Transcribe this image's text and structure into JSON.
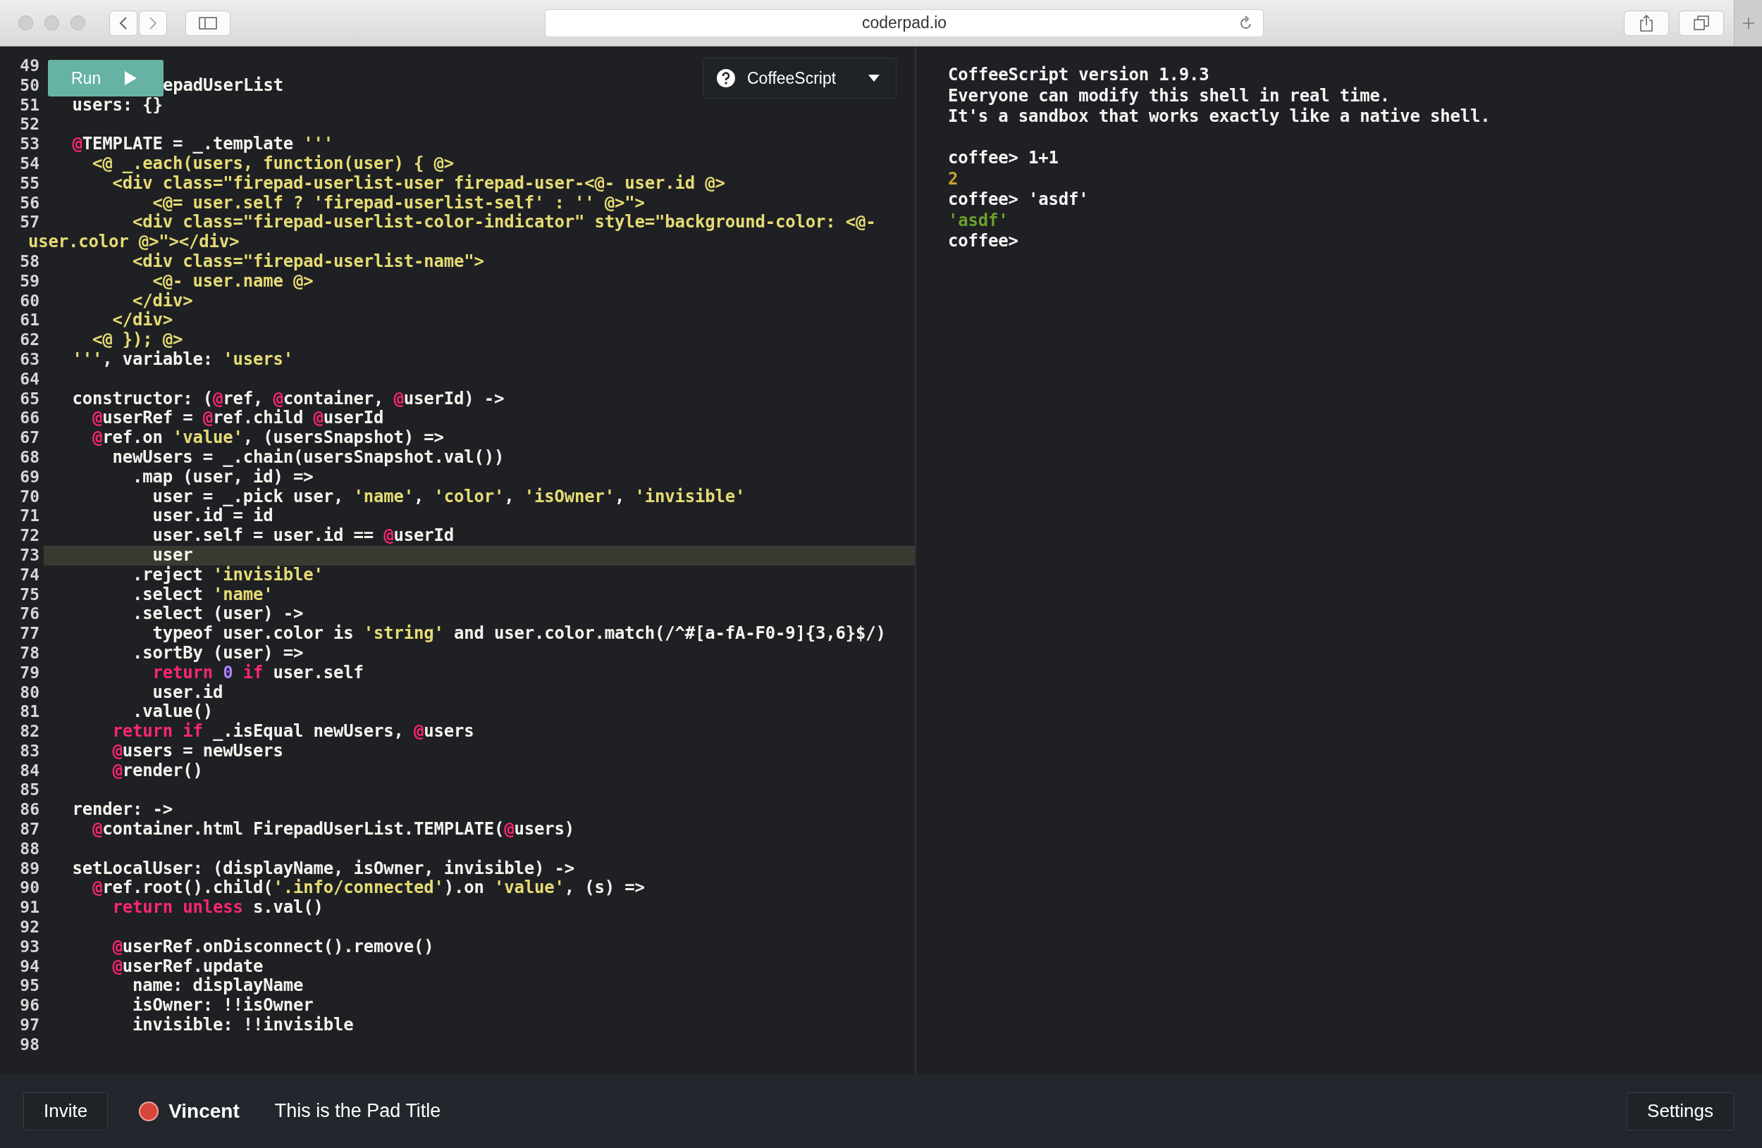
{
  "browser": {
    "url": "coderpad.io"
  },
  "editor": {
    "run_button": "Run",
    "language": "CoffeeScript",
    "lines": [
      {
        "number": "49",
        "active": false
      },
      {
        "number": "50",
        "active": false,
        "covered": true,
        "segments": [
          {
            "kind": "plain",
            "text": "epadUserList"
          }
        ]
      },
      {
        "number": "51",
        "active": false,
        "segments": [
          {
            "kind": "plain",
            "text": "  users: {}"
          }
        ]
      },
      {
        "number": "52",
        "active": false
      },
      {
        "number": "53",
        "active": false,
        "segments": [
          {
            "kind": "at",
            "text": "  @"
          },
          {
            "kind": "plain",
            "text": "TEMPLATE = _.template "
          },
          {
            "kind": "string",
            "text": "'''"
          }
        ]
      },
      {
        "number": "54",
        "active": false,
        "segments": [
          {
            "kind": "string",
            "text": "    <@ _.each(users, function(user) { @>"
          }
        ]
      },
      {
        "number": "55",
        "active": false,
        "segments": [
          {
            "kind": "string",
            "text": "      <div class=\"firepad-userlist-user firepad-user-<@- user.id @>"
          }
        ]
      },
      {
        "number": "56",
        "active": false,
        "segments": [
          {
            "kind": "string",
            "text": "          <@= user.self ? 'firepad-userlist-self' : '' @>\">"
          }
        ]
      },
      {
        "number": "57",
        "active": false,
        "segments": [
          {
            "kind": "string",
            "text": "        <div class=\"firepad-userlist-color-indicator\" style=\"background-color: <@-"
          }
        ],
        "wrap_segments": [
          {
            "kind": "string",
            "text": "user.color @>\"></div>"
          }
        ]
      },
      {
        "number": "58",
        "active": false,
        "segments": [
          {
            "kind": "string",
            "text": "        <div class=\"firepad-userlist-name\">"
          }
        ]
      },
      {
        "number": "59",
        "active": false,
        "segments": [
          {
            "kind": "string",
            "text": "          <@- user.name @>"
          }
        ]
      },
      {
        "number": "60",
        "active": false,
        "segments": [
          {
            "kind": "string",
            "text": "        </div>"
          }
        ]
      },
      {
        "number": "61",
        "active": false,
        "segments": [
          {
            "kind": "string",
            "text": "      </div>"
          }
        ]
      },
      {
        "number": "62",
        "active": false,
        "segments": [
          {
            "kind": "string",
            "text": "    <@ }); @>"
          }
        ]
      },
      {
        "number": "63",
        "active": false,
        "segments": [
          {
            "kind": "string",
            "text": "  '''"
          },
          {
            "kind": "plain",
            "text": ", variable: "
          },
          {
            "kind": "string",
            "text": "'users'"
          }
        ]
      },
      {
        "number": "64",
        "active": false
      },
      {
        "number": "65",
        "active": false,
        "segments": [
          {
            "kind": "plain",
            "text": "  constructor: ("
          },
          {
            "kind": "at",
            "text": "@"
          },
          {
            "kind": "plain",
            "text": "ref, "
          },
          {
            "kind": "at",
            "text": "@"
          },
          {
            "kind": "plain",
            "text": "container, "
          },
          {
            "kind": "at",
            "text": "@"
          },
          {
            "kind": "plain",
            "text": "userId) ->"
          }
        ]
      },
      {
        "number": "66",
        "active": false,
        "segments": [
          {
            "kind": "at",
            "text": "    @"
          },
          {
            "kind": "plain",
            "text": "userRef = "
          },
          {
            "kind": "at",
            "text": "@"
          },
          {
            "kind": "plain",
            "text": "ref.child "
          },
          {
            "kind": "at",
            "text": "@"
          },
          {
            "kind": "plain",
            "text": "userId"
          }
        ]
      },
      {
        "number": "67",
        "active": false,
        "segments": [
          {
            "kind": "at",
            "text": "    @"
          },
          {
            "kind": "plain",
            "text": "ref.on "
          },
          {
            "kind": "string",
            "text": "'value'"
          },
          {
            "kind": "plain",
            "text": ", (usersSnapshot) =>"
          }
        ]
      },
      {
        "number": "68",
        "active": false,
        "segments": [
          {
            "kind": "plain",
            "text": "      newUsers = _.chain(usersSnapshot.val())"
          }
        ]
      },
      {
        "number": "69",
        "active": false,
        "segments": [
          {
            "kind": "plain",
            "text": "        .map (user, id) =>"
          }
        ]
      },
      {
        "number": "70",
        "active": false,
        "segments": [
          {
            "kind": "plain",
            "text": "          user = _.pick user, "
          },
          {
            "kind": "string",
            "text": "'name'"
          },
          {
            "kind": "plain",
            "text": ", "
          },
          {
            "kind": "string",
            "text": "'color'"
          },
          {
            "kind": "plain",
            "text": ", "
          },
          {
            "kind": "string",
            "text": "'isOwner'"
          },
          {
            "kind": "plain",
            "text": ", "
          },
          {
            "kind": "string",
            "text": "'invisible'"
          }
        ]
      },
      {
        "number": "71",
        "active": false,
        "segments": [
          {
            "kind": "plain",
            "text": "          user.id = id"
          }
        ]
      },
      {
        "number": "72",
        "active": false,
        "segments": [
          {
            "kind": "plain",
            "text": "          user.self = user.id == "
          },
          {
            "kind": "at",
            "text": "@"
          },
          {
            "kind": "plain",
            "text": "userId"
          }
        ]
      },
      {
        "number": "73",
        "active": true,
        "segments": [
          {
            "kind": "plain",
            "text": "          user"
          }
        ]
      },
      {
        "number": "74",
        "active": false,
        "segments": [
          {
            "kind": "plain",
            "text": "        .reject "
          },
          {
            "kind": "string",
            "text": "'invisible'"
          }
        ]
      },
      {
        "number": "75",
        "active": false,
        "segments": [
          {
            "kind": "plain",
            "text": "        .select "
          },
          {
            "kind": "string",
            "text": "'name'"
          }
        ]
      },
      {
        "number": "76",
        "active": false,
        "segments": [
          {
            "kind": "plain",
            "text": "        .select (user) ->"
          }
        ]
      },
      {
        "number": "77",
        "active": false,
        "segments": [
          {
            "kind": "plain",
            "text": "          typeof user.color is "
          },
          {
            "kind": "string",
            "text": "'string'"
          },
          {
            "kind": "plain",
            "text": " and user.color.match(/^#[a-fA-F0-9]{3,6}$/)"
          }
        ]
      },
      {
        "number": "78",
        "active": false,
        "segments": [
          {
            "kind": "plain",
            "text": "        .sortBy (user) =>"
          }
        ]
      },
      {
        "number": "79",
        "active": false,
        "segments": [
          {
            "kind": "keyword",
            "text": "          return"
          },
          {
            "kind": "number",
            "text": " 0"
          },
          {
            "kind": "keyword",
            "text": " if"
          },
          {
            "kind": "plain",
            "text": " user.self"
          }
        ]
      },
      {
        "number": "80",
        "active": false,
        "segments": [
          {
            "kind": "plain",
            "text": "          user.id"
          }
        ]
      },
      {
        "number": "81",
        "active": false,
        "segments": [
          {
            "kind": "plain",
            "text": "        .value()"
          }
        ]
      },
      {
        "number": "82",
        "active": false,
        "segments": [
          {
            "kind": "keyword",
            "text": "      return if"
          },
          {
            "kind": "plain",
            "text": " _.isEqual newUsers, "
          },
          {
            "kind": "at",
            "text": "@"
          },
          {
            "kind": "plain",
            "text": "users"
          }
        ]
      },
      {
        "number": "83",
        "active": false,
        "segments": [
          {
            "kind": "at",
            "text": "      @"
          },
          {
            "kind": "plain",
            "text": "users = newUsers"
          }
        ]
      },
      {
        "number": "84",
        "active": false,
        "segments": [
          {
            "kind": "at",
            "text": "      @"
          },
          {
            "kind": "plain",
            "text": "render()"
          }
        ]
      },
      {
        "number": "85",
        "active": false
      },
      {
        "number": "86",
        "active": false,
        "segments": [
          {
            "kind": "plain",
            "text": "  render: ->"
          }
        ]
      },
      {
        "number": "87",
        "active": false,
        "segments": [
          {
            "kind": "at",
            "text": "    @"
          },
          {
            "kind": "plain",
            "text": "container.html FirepadUserList.TEMPLATE("
          },
          {
            "kind": "at",
            "text": "@"
          },
          {
            "kind": "plain",
            "text": "users)"
          }
        ]
      },
      {
        "number": "88",
        "active": false
      },
      {
        "number": "89",
        "active": false,
        "segments": [
          {
            "kind": "plain",
            "text": "  setLocalUser: (displayName, isOwner, invisible) ->"
          }
        ]
      },
      {
        "number": "90",
        "active": false,
        "segments": [
          {
            "kind": "at",
            "text": "    @"
          },
          {
            "kind": "plain",
            "text": "ref.root().child("
          },
          {
            "kind": "string",
            "text": "'.info/connected'"
          },
          {
            "kind": "plain",
            "text": ").on "
          },
          {
            "kind": "string",
            "text": "'value'"
          },
          {
            "kind": "plain",
            "text": ", (s) =>"
          }
        ]
      },
      {
        "number": "91",
        "active": false,
        "segments": [
          {
            "kind": "keyword",
            "text": "      return unless"
          },
          {
            "kind": "plain",
            "text": " s.val()"
          }
        ]
      },
      {
        "number": "92",
        "active": false
      },
      {
        "number": "93",
        "active": false,
        "segments": [
          {
            "kind": "at",
            "text": "      @"
          },
          {
            "kind": "plain",
            "text": "userRef.onDisconnect().remove()"
          }
        ]
      },
      {
        "number": "94",
        "active": false,
        "segments": [
          {
            "kind": "at",
            "text": "      @"
          },
          {
            "kind": "plain",
            "text": "userRef.update"
          }
        ]
      },
      {
        "number": "95",
        "active": false,
        "segments": [
          {
            "kind": "plain",
            "text": "        name: displayName"
          }
        ]
      },
      {
        "number": "96",
        "active": false,
        "segments": [
          {
            "kind": "plain",
            "text": "        isOwner: !!isOwner"
          }
        ]
      },
      {
        "number": "97",
        "active": false,
        "segments": [
          {
            "kind": "plain",
            "text": "        invisible: !!invisible"
          }
        ]
      },
      {
        "number": "98",
        "active": false
      }
    ]
  },
  "console": {
    "lines": [
      {
        "kind": "output",
        "text": "CoffeeScript version 1.9.3"
      },
      {
        "kind": "output",
        "text": "Everyone can modify this shell in real time."
      },
      {
        "kind": "output",
        "text": "It's a sandbox that works exactly like a native shell."
      },
      {
        "kind": "blank"
      },
      {
        "kind": "output",
        "text": "coffee> 1+1"
      },
      {
        "kind": "number",
        "text": "2"
      },
      {
        "kind": "output",
        "text": "coffee> 'asdf'"
      },
      {
        "kind": "string",
        "text": "'asdf'"
      },
      {
        "kind": "output",
        "text": "coffee>"
      }
    ]
  },
  "footer": {
    "invite_button": "Invite",
    "user": {
      "name": "Vincent",
      "color": "#d9463a"
    },
    "pad_title": "This is the Pad Title",
    "settings_button": "Settings"
  }
}
